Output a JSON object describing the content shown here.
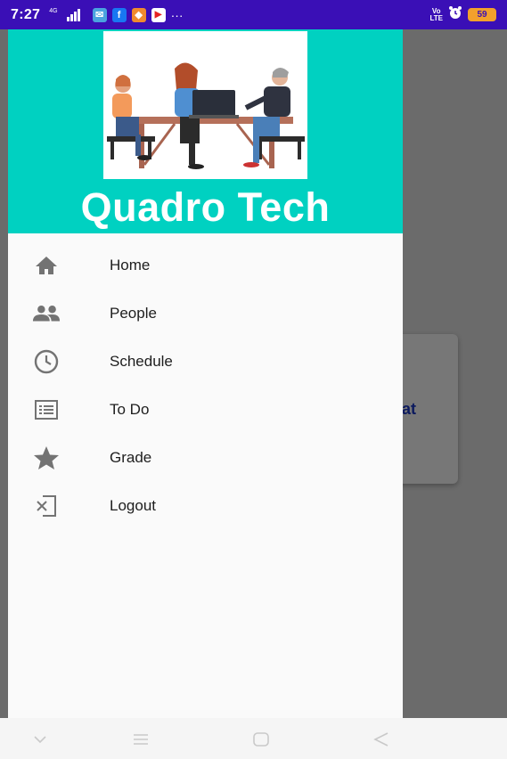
{
  "status_bar": {
    "time": "7:27",
    "network_label": "4G",
    "more": "···",
    "volte_top": "Vo",
    "volte_bottom": "LTE",
    "battery": "59",
    "app_icons": [
      {
        "name": "messages-icon",
        "color": "#4aa3df",
        "glyph": "✉"
      },
      {
        "name": "facebook-icon",
        "color": "#1877f2",
        "glyph": "f"
      },
      {
        "name": "photos-icon",
        "color": "#f08a2e",
        "glyph": "◆"
      },
      {
        "name": "youtube-icon",
        "color": "#e52222",
        "glyph": "▶"
      }
    ]
  },
  "background": {
    "card_text": "hat"
  },
  "drawer": {
    "header_color": "#00d1c1",
    "brand": "Quadro Tech",
    "items": [
      {
        "label": "Home",
        "icon": "home-icon"
      },
      {
        "label": "People",
        "icon": "people-icon"
      },
      {
        "label": "Schedule",
        "icon": "clock-icon"
      },
      {
        "label": "To Do",
        "icon": "list-icon"
      },
      {
        "label": "Grade",
        "icon": "star-icon"
      },
      {
        "label": "Logout",
        "icon": "logout-icon"
      }
    ]
  },
  "colors": {
    "status_bar": "#3a0fb6",
    "scrim": "#6b6b6b",
    "icon_gray": "#737373"
  }
}
